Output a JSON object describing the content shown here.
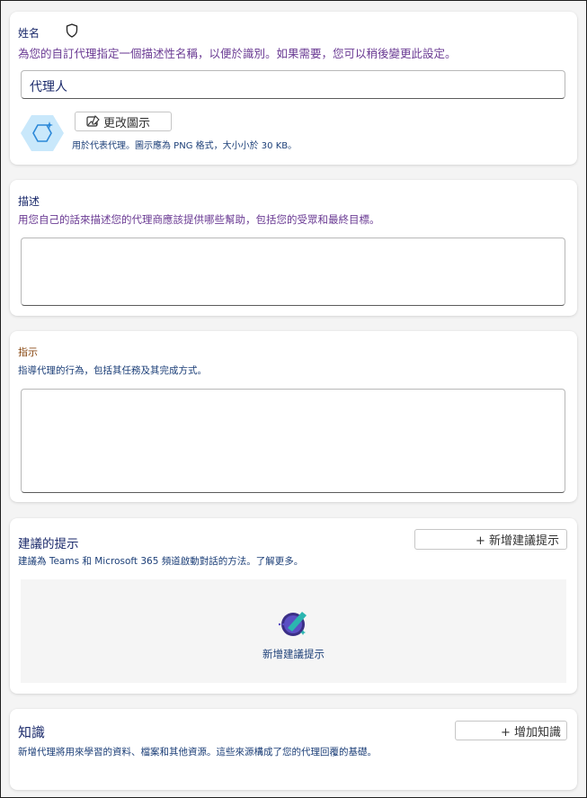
{
  "name_section": {
    "title": "姓名",
    "description": "為您的自訂代理指定一個描述性名稱，以便於識別。如果需要，您可以稍後變更此設定。",
    "input_value": "代理人",
    "change_icon_label": "更改圖示",
    "icon_hint": "用於代表代理。圖示應為 PNG 格式，大小小於 30 KB。"
  },
  "description_section": {
    "title": "描述",
    "description": "用您自己的話來描述您的代理商應該提供哪些幫助，包括您的受眾和最終目標。",
    "value": ""
  },
  "instructions_section": {
    "title": "指示",
    "description": "指導代理的行為，包括其任務及其完成方式。",
    "value": ""
  },
  "prompts_section": {
    "title": "建議的提示",
    "description": "建議為 Teams 和 Microsoft 365 頻道啟動對話的方法。了解更多。",
    "add_button_label": "+ 新增建議提示",
    "empty_state_label": "新增建議提示"
  },
  "knowledge_section": {
    "title": "知識",
    "description": "新增代理將用來學習的資料、檔案和其他資源。這些來源構成了您的代理回覆的基礎。",
    "add_button_label": "+ 增加知識"
  },
  "colors": {
    "title": "#1b2a6b",
    "purple_text": "#6a3a93",
    "blue_text": "#1c3f78",
    "hexagon": "#c9e8fb"
  }
}
